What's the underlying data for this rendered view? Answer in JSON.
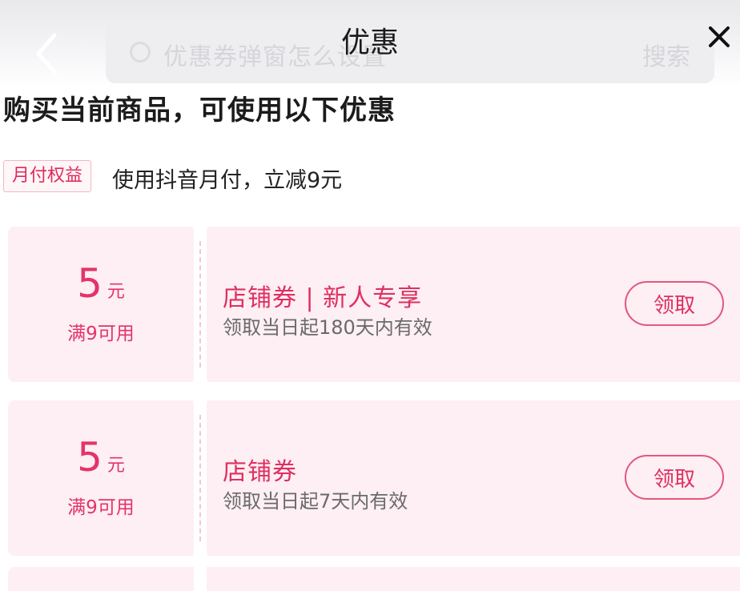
{
  "header": {
    "title": "优惠",
    "search_placeholder": "优惠券弹窗怎么设置",
    "search_button": "搜索"
  },
  "headline": "购买当前商品，可使用以下优惠",
  "payment_benefit": {
    "tag": "月付权益",
    "description": "使用抖音月付，立减9元"
  },
  "coupons": [
    {
      "amount": "5",
      "unit": "元",
      "condition": "满9可用",
      "title": "店铺券 | 新人专享",
      "validity": "领取当日起180天内有效",
      "button": "领取"
    },
    {
      "amount": "5",
      "unit": "元",
      "condition": "满9可用",
      "title": "店铺券",
      "validity": "领取当日起7天内有效",
      "button": "领取"
    }
  ],
  "colors": {
    "accent": "#e4336a",
    "coupon_bg": "#fdeff3"
  }
}
